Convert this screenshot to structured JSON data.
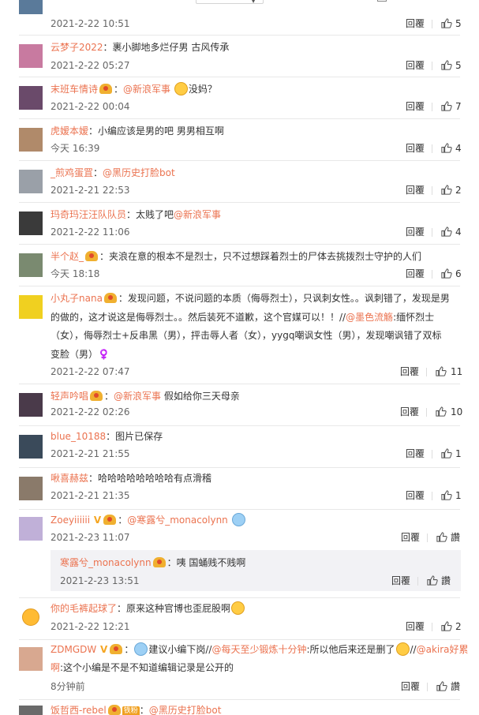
{
  "ui": {
    "reply_label": "回覆",
    "zan_label": "讚"
  },
  "comments": [
    {
      "user": "",
      "time": "2021-2-22 10:51",
      "likes": "5",
      "avatar": "#5a7a9a"
    },
    {
      "user": "云梦子2022",
      "text": "：裹小脚地多烂仔男 古风传承",
      "time": "2021-2-22 05:27",
      "likes": "5",
      "avatar": "#c87aa0"
    },
    {
      "user": "末班车情诗",
      "mention": "@新浪军事",
      "text": "没妈？",
      "time": "2021-2-22 00:04",
      "likes": "7",
      "avatar": "#6a4a6a"
    },
    {
      "user": "虎嫒本嫒",
      "text": "：小编应该是男的吧 男男相互啊",
      "time": "今天 16:39",
      "likes": "4",
      "avatar": "#b08a6a"
    },
    {
      "user": "_煎鸡蛋罝",
      "mention": "@黑历史打脸bot",
      "time": "2021-2-21 22:53",
      "likes": "2",
      "avatar": "#9aa0a8"
    },
    {
      "user": "玛奇玛汪汪队队员",
      "text": "：太贱了吧",
      "mention": "@新浪军事",
      "time": "2021-2-22 11:06",
      "likes": "4",
      "avatar": "#3a3a3a"
    },
    {
      "user": "半个赵_",
      "text": "：夹浪在意的根本不是烈士，只不过想踩着烈士的尸体去挑拨烈士守护的人们",
      "time": "今天 18:18",
      "likes": "6",
      "avatar": "#7a8a70"
    },
    {
      "user": "小丸子nana",
      "line1": "：发现问题，不说问题的本质（侮辱烈士），只讽刺女性。。讽刺错了，发现是男",
      "line2a": "的做的，这才说这是侮辱烈士。。然后装死不道歉，这个官媒可以！！//",
      "mention": "@墨色流觞",
      "line2b": ":缅怀烈士",
      "line3": "（女），侮辱烈士+反串黑（男），抨击辱人者（女），yygq嘲讽女性（男），发现嘲讽错了双标",
      "line4": "变脸（男）♀️",
      "time": "2021-2-22 07:47",
      "likes": "11",
      "avatar": "#f0d020"
    },
    {
      "user": "轻声吟唱",
      "mention": "@新浪军事",
      "text": " 假如给你三天母亲",
      "time": "2021-2-22 02:26",
      "likes": "10",
      "avatar": "#4a3a4a"
    },
    {
      "user": "blue_10188",
      "text": "：图片已保存",
      "time": "2021-2-21 21:55",
      "likes": "1",
      "avatar": "#3a4a5a"
    },
    {
      "user": "啾喜赫兹",
      "text": "：哈哈哈哈哈哈哈哈有点滑稽",
      "time": "2021-2-21 21:35",
      "likes": "1",
      "avatar": "#8a7a6a"
    },
    {
      "user": "Zoeyiiiiii",
      "mention": "@寒露兮_monacolynn",
      "time": "2021-2-23 11:07",
      "avatar": "#c0b0d8",
      "sub": {
        "user": "寒露兮_monacolynn",
        "text": "：咦 国蛹贱不贱啊",
        "time": "2021-2-23 13:51"
      }
    },
    {
      "user": "你的毛裤起球了",
      "text": "：原来这种官博也歪屁股啊",
      "time": "2021-2-22 12:21",
      "likes": "2",
      "avatar": "#ffbb33"
    },
    {
      "user": "ZDMGDW",
      "line1a": "：",
      "line1b": "建议小编下岗//",
      "mention1": "@每天至少锻炼十分钟",
      "line1c": ":所以他后来还是删了",
      "mention2": "@akira好累",
      "mention2b": "啊",
      "line2": ":这个小编是不是不知道编辑记录是公开的",
      "time": "8分钟前",
      "avatar": "#d8a890"
    },
    {
      "user": "饭哲西-rebel",
      "fan": "铁粉",
      "mention": "@黑历史打脸bot",
      "avatar": "#6a6a6a"
    }
  ]
}
